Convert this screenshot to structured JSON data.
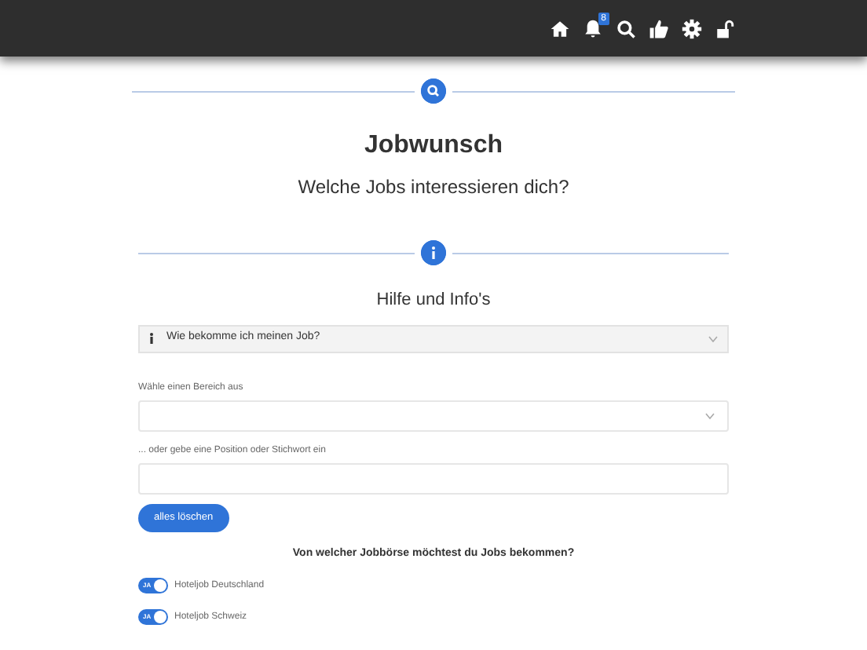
{
  "header": {
    "notification_badge": "8"
  },
  "section_1": {
    "title": "Jobwunsch",
    "subtitle": "Welche Jobs interessieren dich?"
  },
  "section_2": {
    "title": "Hilfe und Info's",
    "accordion": {
      "label": "Wie bekomme ich meinen Job?",
      "expanded": false
    }
  },
  "form": {
    "area_label": "Wähle einen Bereich aus",
    "keyword_label": "... oder gebe eine Position oder Stichwort ein",
    "clear_button": "alles löschen"
  },
  "job_boards": {
    "question": "Von welcher Jobbörse möchtest du Jobs bekommen?",
    "items": [
      {
        "label": "Hoteljob Deutschland",
        "on": true,
        "switch_text": "JA"
      },
      {
        "label": "Hoteljob Schweiz",
        "on": true,
        "switch_text": "JA"
      }
    ]
  }
}
